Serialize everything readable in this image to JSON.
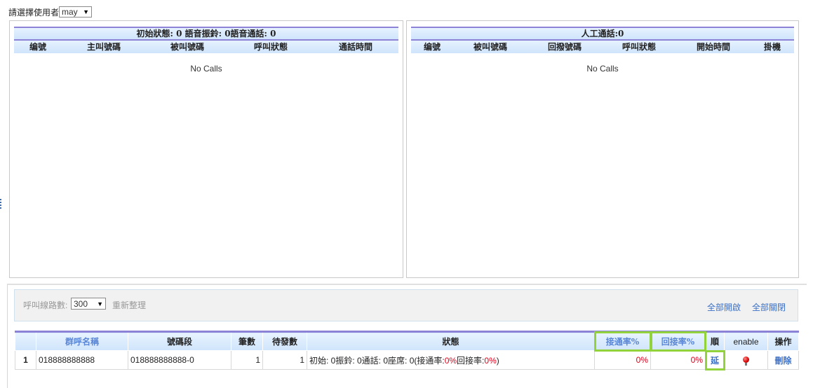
{
  "user_select": {
    "label": "請選擇使用者",
    "value": "may"
  },
  "left_panel": {
    "title": "初始狀態: 0 語音振鈴: 0語音通話: 0",
    "columns": [
      "编號",
      "主叫號碼",
      "被叫號碼",
      "呼叫狀態",
      "通話時間"
    ],
    "empty_text": "No Calls"
  },
  "right_panel": {
    "title": "人工通話:0",
    "columns": [
      "编號",
      "被叫號碼",
      "回撥號碼",
      "呼叫狀態",
      "開始時間",
      "掛機"
    ],
    "empty_text": "No Calls"
  },
  "toolbar": {
    "lines_label": "呼叫線路數:",
    "lines_value": "300",
    "refresh": "重新整理",
    "open_all": "全部開啟",
    "close_all": "全部關閉"
  },
  "group_table": {
    "headers": [
      "",
      "群呼名稱",
      "號碼段",
      "筆數",
      "待發數",
      "狀態",
      "接通率%",
      "回接率%",
      "順",
      "enable",
      "操作"
    ],
    "rows": [
      {
        "index": "1",
        "name": "018888888888",
        "range": "018888888888-0",
        "count": "1",
        "pending": "1",
        "status_prefix": "初始: 0振鈴: 0通話: 0座席: 0(接通率:",
        "status_rate1": "0%",
        "status_mid": "回接率:",
        "status_rate2": "0%",
        "status_suffix": ")",
        "connect_rate": "0%",
        "callback_rate": "0%",
        "order_action": "延",
        "enable_icon": "red-bulb-icon",
        "delete_label": "刪除"
      }
    ]
  }
}
